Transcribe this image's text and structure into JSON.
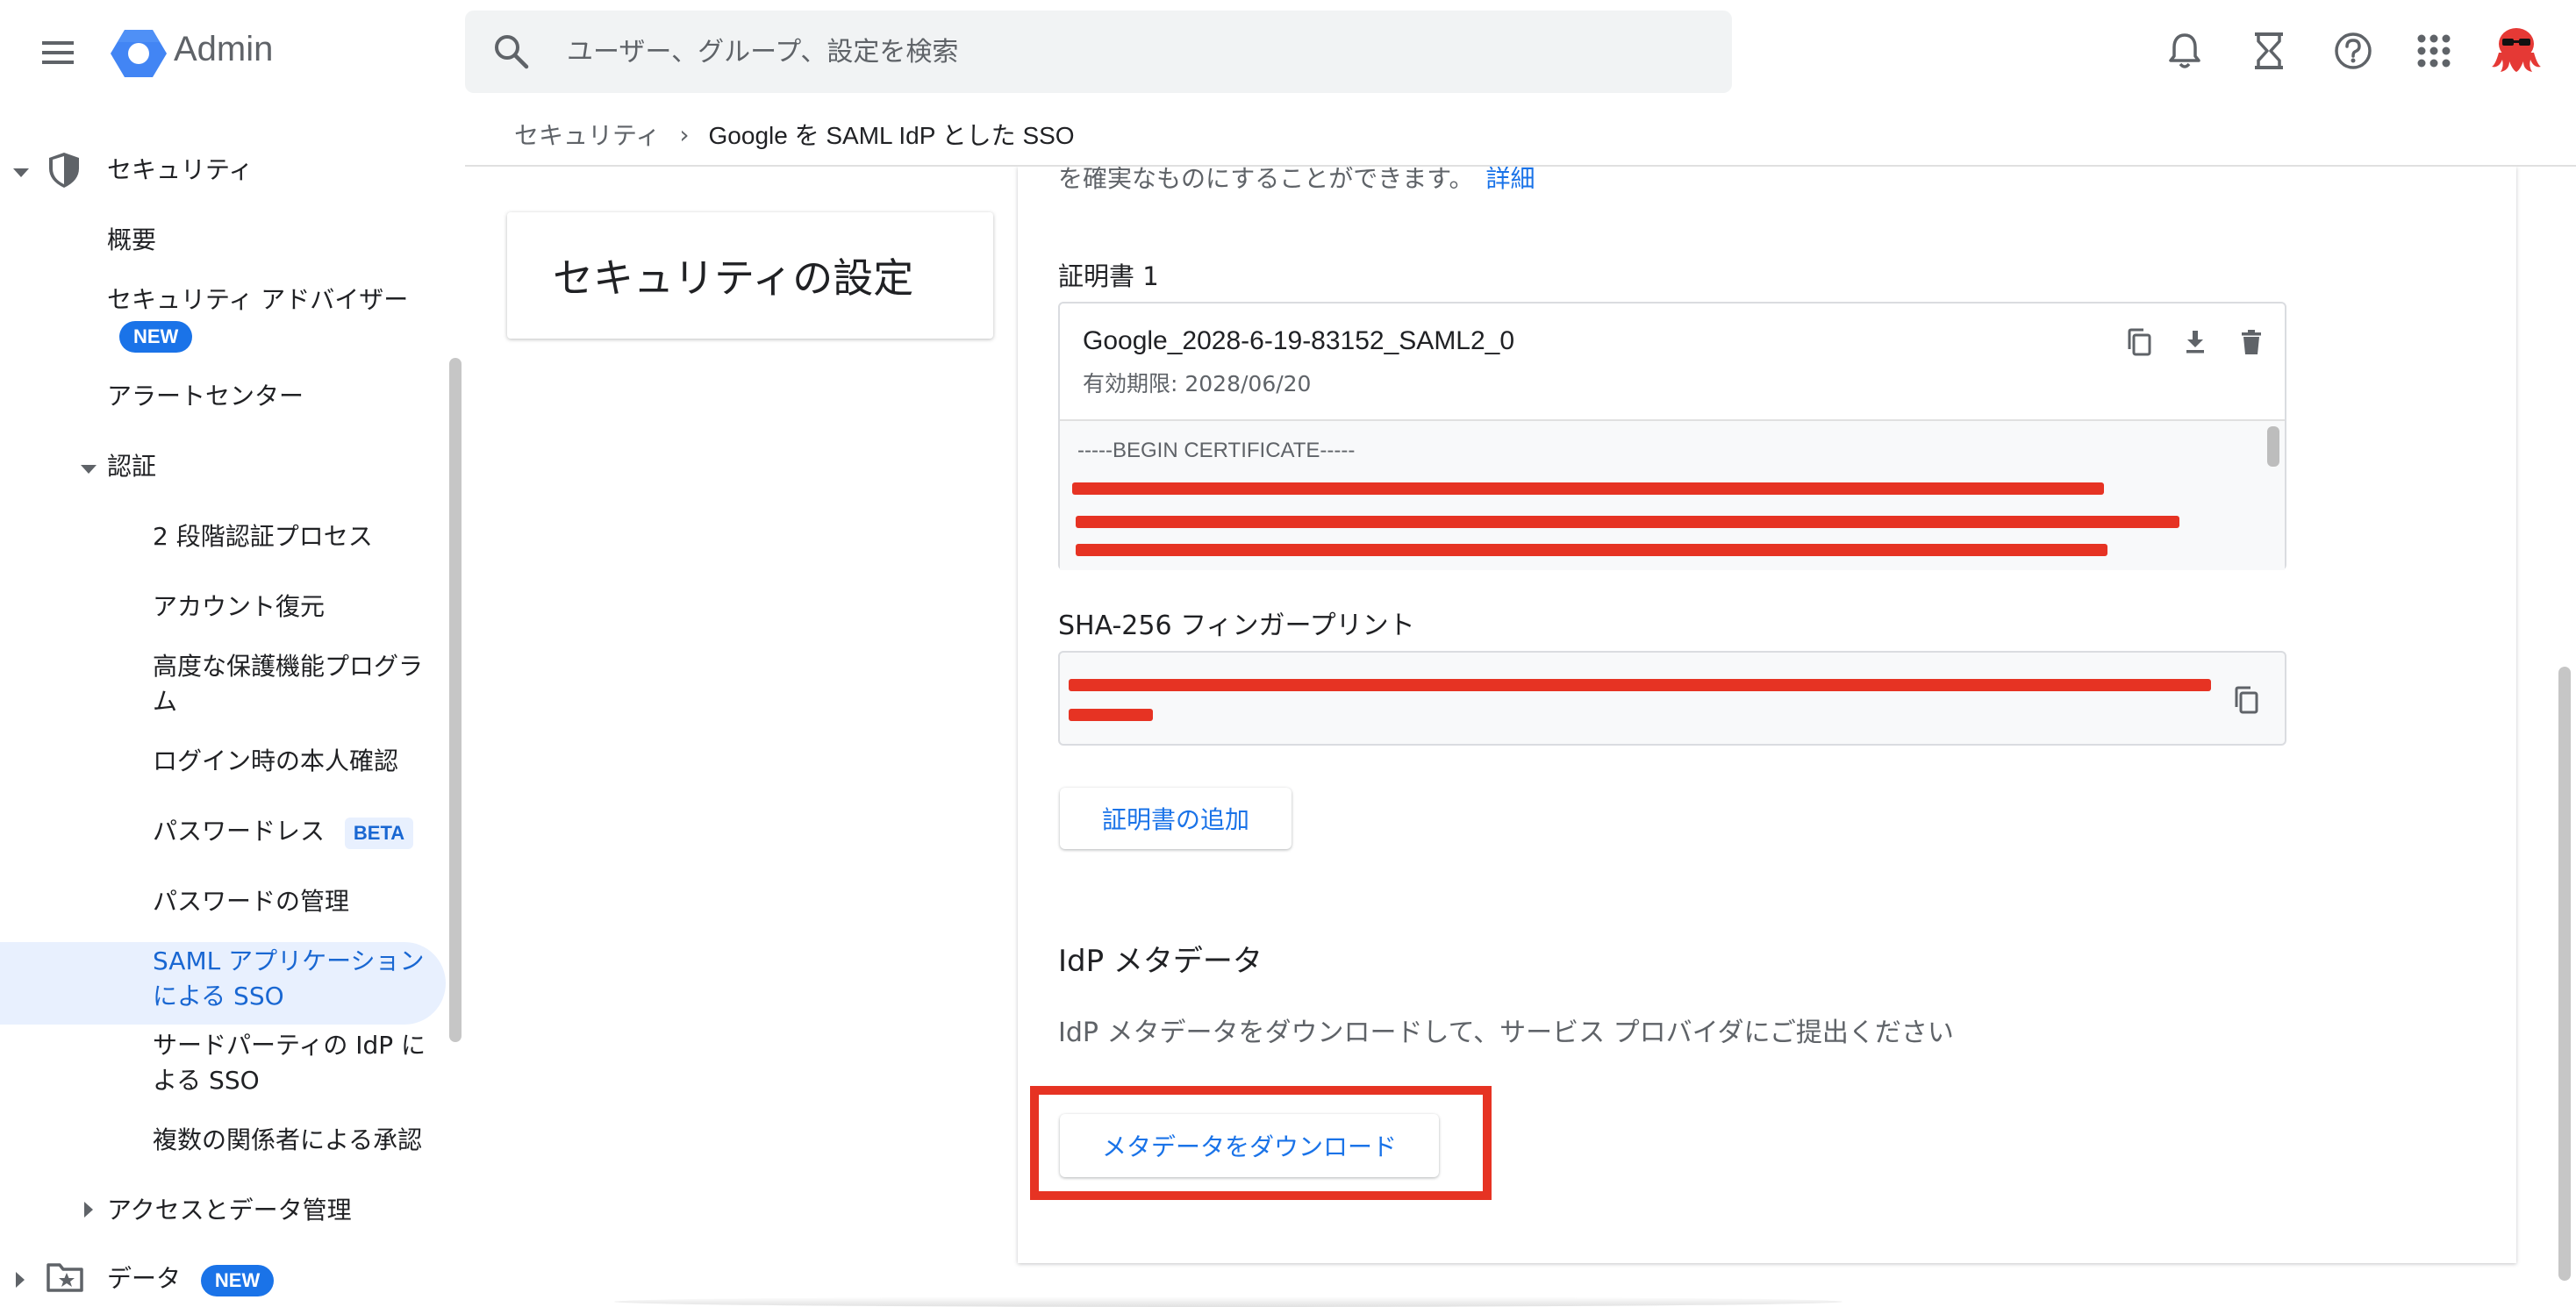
{
  "app": {
    "title": "Admin"
  },
  "search": {
    "placeholder": "ユーザー、グループ、設定を検索"
  },
  "breadcrumb": {
    "parent": "セキュリティ",
    "separator": "›",
    "current": "Google を SAML IdP とした SSO"
  },
  "sidebar": {
    "security": "セキュリティ",
    "overview": "概要",
    "advisor": "セキュリティ アドバイザー",
    "advisor_badge": "NEW",
    "alert_center": "アラートセンター",
    "auth": "認証",
    "two_step": "2 段階認証プロセス",
    "account_recovery": "アカウント復元",
    "advanced_protection_1": "高度な保護機能プログラ",
    "advanced_protection_2": "ム",
    "login_challenge": "ログイン時の本人確認",
    "passwordless": "パスワードレス",
    "passwordless_badge": "BETA",
    "password_management": "パスワードの管理",
    "saml_sso_1": "SAML アプリケーション",
    "saml_sso_2": "による SSO",
    "third_party_1": "サードパーティの IdP に",
    "third_party_2": "よる SSO",
    "multi_party": "複数の関係者による承認",
    "access_data": "アクセスとデータ管理",
    "data": "データ",
    "data_badge": "NEW"
  },
  "settings_card": {
    "title": "セキュリティの設定"
  },
  "main": {
    "intro": "を確実なものにすることができます。",
    "intro_link": "詳細",
    "cert_label": "証明書 1",
    "cert_name": "Google_2028-6-19-83152_SAML2_0",
    "cert_expiry": "有効期限: 2028/06/20",
    "cert_begin": "-----BEGIN CERTIFICATE-----",
    "fingerprint_label": "SHA-256 フィンガープリント",
    "add_cert_button": "証明書の追加",
    "idp_title": "IdP メタデータ",
    "idp_desc": "IdP メタデータをダウンロードして、サービス プロバイダにご提出ください",
    "download_button": "メタデータをダウンロード"
  },
  "colors": {
    "accent": "#1a73e8",
    "highlight": "#e63323",
    "active_bg": "#e8f0fe"
  },
  "icons": [
    "menu-icon",
    "admin-logo-icon",
    "search-icon",
    "bell-icon",
    "hourglass-icon",
    "help-icon",
    "apps-grid-icon",
    "avatar",
    "shield-icon",
    "folder-star-icon",
    "copy-icon",
    "download-icon",
    "delete-icon"
  ]
}
